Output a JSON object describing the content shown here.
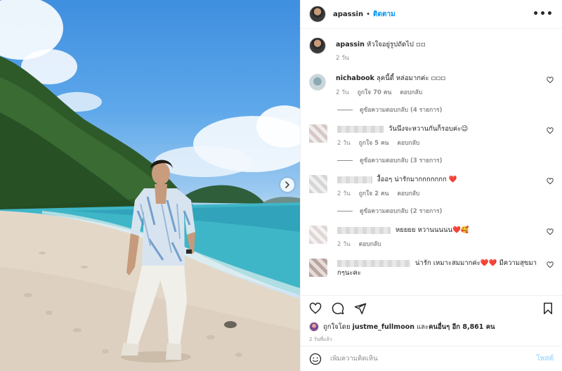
{
  "post": {
    "username": "apassin",
    "separator": "•",
    "follow_label": "ติดตาม",
    "more_icon": "more-horizontal-icon"
  },
  "caption": {
    "username": "apassin",
    "text": "หัวใจอยู่รูปถัดไป ◽◽",
    "time": "2 วัน"
  },
  "comments": [
    {
      "username": "nichabook",
      "text": "ลุคนี้ดี้ หล่อมากค่ะ ◽◽◽",
      "time": "2 วัน",
      "likes": "ถูกใจ 70 คน",
      "reply_label": "ตอบกลับ",
      "view_replies": "ดูข้อความตอบกลับ (4 รายการ)"
    },
    {
      "username": "",
      "text": "วันนึงจะหวานกันก็รอบค่ะ😉",
      "time": "2 วัน",
      "likes": "ถูกใจ 5 คน",
      "reply_label": "ตอบกลับ",
      "view_replies": "ดูข้อความตอบกลับ (3 รายการ)"
    },
    {
      "username": "",
      "text": "งื้ออๆ น่ารักมากกกกกกก ❤️",
      "time": "2 วัน",
      "likes": "ถูกใจ 2 คน",
      "reply_label": "ตอบกลับ",
      "view_replies": "ดูข้อความตอบกลับ (2 รายการ)"
    },
    {
      "username": "",
      "text": "หยยยย หวานนนนน❤️🥰",
      "time": "2 วัน",
      "likes": "",
      "reply_label": "ตอบกลับ",
      "view_replies": ""
    },
    {
      "username": "",
      "text": "น่ารัก เหมาะสมมากค่ะ❤️❤️ มีความสุขมากๆนะคะ",
      "time": "",
      "likes": "",
      "reply_label": "",
      "view_replies": ""
    }
  ],
  "likes_line": {
    "prefix": "ถูกใจโดย",
    "user": "justme_fullmoon",
    "middle": "และ",
    "others": "คนอื่นๆ อีก 8,861 คน"
  },
  "posted_time": "2 วันที่แล้ว",
  "add_comment": {
    "placeholder": "เพิ่มความคิดเห็น",
    "post_label": "โพสต์"
  },
  "colors": {
    "accent": "#0095f6",
    "post_disabled": "#b2dffc",
    "heart": "#ed4956"
  }
}
